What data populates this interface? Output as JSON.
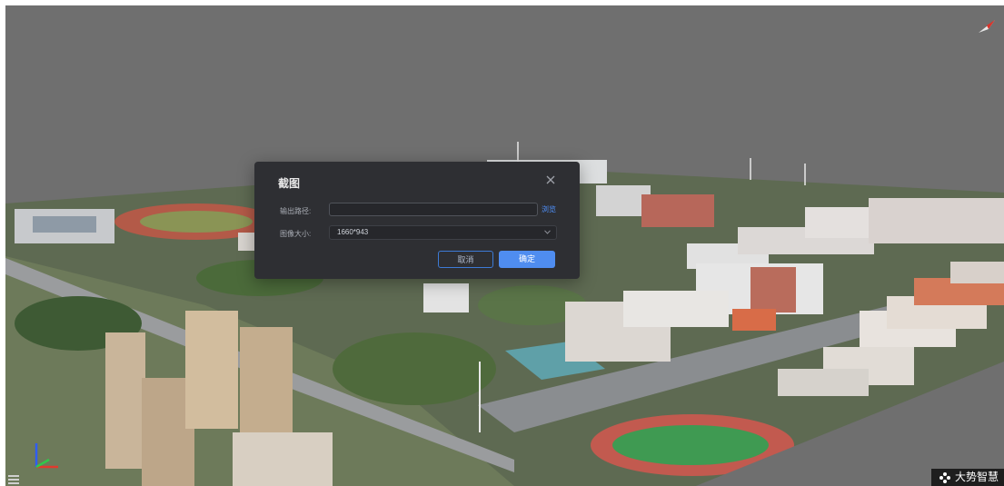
{
  "dialog": {
    "title": "截图",
    "output_path_label": "输出路径:",
    "output_path_value": "",
    "browse_label": "浏览",
    "image_size_label": "图像大小:",
    "image_size_value": "1660*943",
    "cancel_label": "取消",
    "confirm_label": "确定"
  },
  "branding": {
    "logo_text": "大势智慧"
  },
  "colors": {
    "viewport_bg": "#6f6f6f",
    "dialog_bg": "#2e2f33",
    "primary": "#4f8df0",
    "link": "#4f92ff"
  },
  "icons": [
    "compass-icon",
    "axes-gizmo-icon",
    "menu-icon",
    "close-icon",
    "chevron-down-icon",
    "logo-mark-icon"
  ]
}
